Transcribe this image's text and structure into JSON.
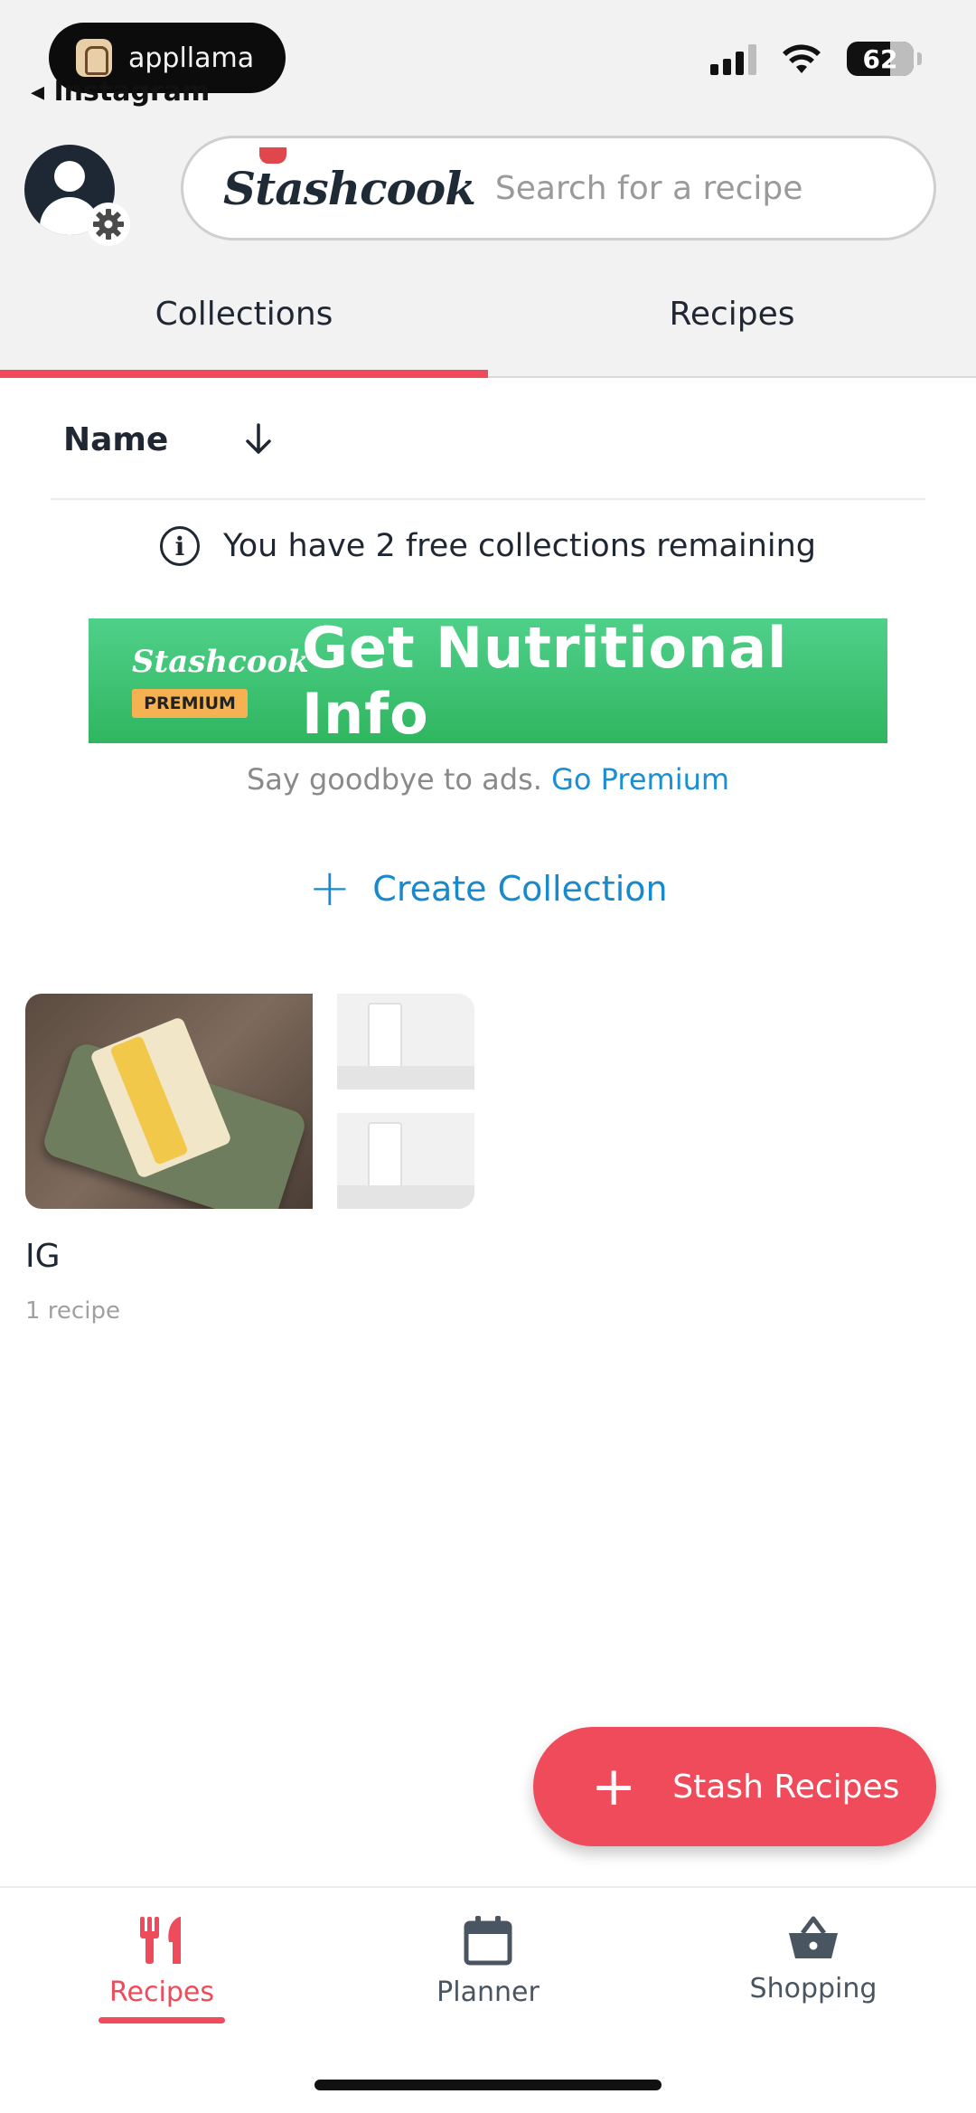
{
  "status_bar": {
    "overlay_app": "appllama",
    "back_app": "◂ Instagram",
    "battery": "62"
  },
  "header": {
    "brand": "Stashcook",
    "search_placeholder": "Search for a recipe"
  },
  "tabs": [
    {
      "label": "Collections",
      "active": true
    },
    {
      "label": "Recipes",
      "active": false
    }
  ],
  "sort": {
    "label": "Name",
    "direction_icon": "arrow-down-icon"
  },
  "info": {
    "text": "You have 2 free collections remaining"
  },
  "banner": {
    "brand": "Stashcook",
    "badge": "PREMIUM",
    "text": "Get Nutritional Info"
  },
  "ads": {
    "text": "Say goodbye to ads.",
    "link": "Go Premium"
  },
  "create_collection": {
    "label": "Create Collection"
  },
  "collections": [
    {
      "name": "IG",
      "count": "1 recipe"
    }
  ],
  "fab": {
    "label": "Stash Recipes"
  },
  "bottom_nav": [
    {
      "label": "Recipes",
      "icon": "fork-knife-icon",
      "active": true
    },
    {
      "label": "Planner",
      "icon": "calendar-icon",
      "active": false
    },
    {
      "label": "Shopping",
      "icon": "basket-icon",
      "active": false
    }
  ],
  "colors": {
    "accent": "#ef4b5a",
    "link": "#1789cc",
    "banner_green": "#2fb65f",
    "dark": "#1f2733"
  }
}
